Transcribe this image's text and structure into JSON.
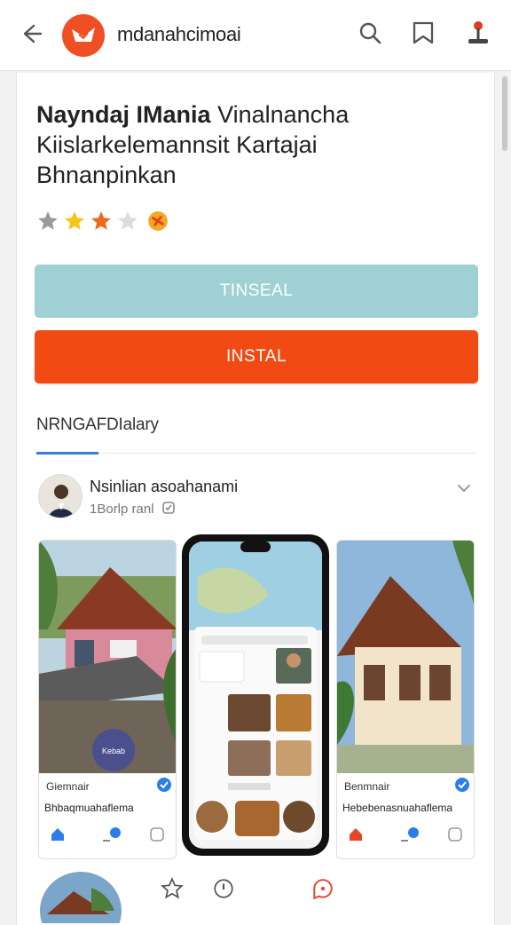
{
  "header": {
    "app_name": "mdanahcimoai",
    "icons": [
      "back-arrow-icon",
      "app-logo",
      "search-icon",
      "bookmark-icon",
      "joystick-icon"
    ]
  },
  "app": {
    "title_bold": "Nayndaj IMania",
    "title_rest": "Vinalnancha",
    "title_line2": "Kiislarkelemannsit Kartajai",
    "title_line3": "Bhnanpinkan",
    "rating_stars": 3
  },
  "buttons": {
    "secondary_label": "TINSEAL",
    "install_label": "INSTAL"
  },
  "section": {
    "tab_label": "NRNGAFDIalary"
  },
  "author": {
    "name": "Nsinlian asoahanami",
    "sub": "1Borlp ranl"
  },
  "screenshots": {
    "left": {
      "name": "Giemnair",
      "desc": "Bhbaqmuahaflema",
      "badge": "Kebab"
    },
    "right": {
      "name": "Benmnair",
      "desc": "Hebebenasnuahaflema"
    }
  },
  "colors": {
    "brand": "#f04e23",
    "install": "#f24a13",
    "secondary": "#9fd0d3",
    "tab_accent": "#3b7bd8"
  }
}
